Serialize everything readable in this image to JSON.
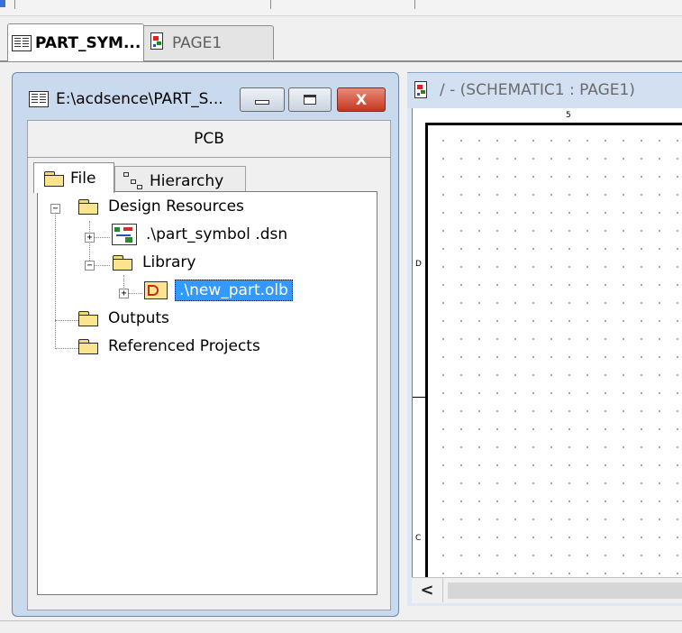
{
  "doc_tabs": [
    {
      "label": "PART_SYM...",
      "active": true,
      "icon": "project-sheet-icon"
    },
    {
      "label": "PAGE1",
      "active": false,
      "icon": "schematic-page-icon"
    }
  ],
  "project_window": {
    "title": "E:\\acdsence\\PART_S...",
    "close_glyph": "X",
    "header": "PCB",
    "tabs": [
      {
        "label": "File",
        "icon": "folder-icon"
      },
      {
        "label": "Hierarchy",
        "icon": "hierarchy-icon"
      }
    ],
    "tree": {
      "design_resources": "Design Resources",
      "design_file": ".\\part_symbol .dsn",
      "library": "Library",
      "library_file": ".\\new_part.olb",
      "outputs": "Outputs",
      "referenced_projects": "Referenced Projects"
    }
  },
  "schematic_window": {
    "title": "/ - (SCHEMATIC1 : PAGE1)",
    "zone_top": "5",
    "zone_left_1": "D",
    "zone_left_2": "C",
    "scroll_left_glyph": "<"
  }
}
